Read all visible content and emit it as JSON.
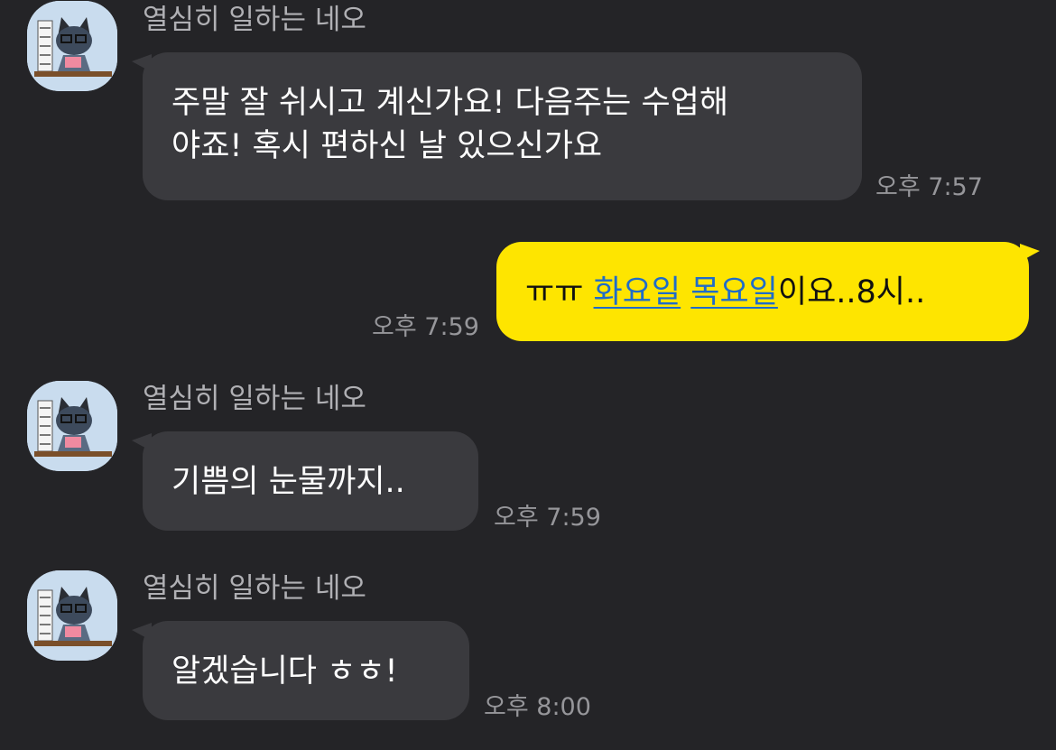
{
  "sender_name": "열심히 일하는 네오",
  "messages": [
    {
      "direction": "incoming",
      "lines": [
        "주말 잘 쉬시고 계신가요! 다음주는 수업해",
        "야죠! 혹시 편하신 날 있으신가요"
      ],
      "time": "오후 7:57"
    },
    {
      "direction": "outgoing",
      "prefix": "ㅠㅠ ",
      "link1": "화요일",
      "space": " ",
      "link2": "목요일",
      "suffix": "이요..8시..",
      "time": "오후 7:59"
    },
    {
      "direction": "incoming",
      "lines": [
        "기쁨의 눈물까지.."
      ],
      "time": "오후 7:59"
    },
    {
      "direction": "incoming",
      "lines": [
        "알겠습니다 ㅎㅎ!"
      ],
      "time": "오후 8:00"
    }
  ],
  "colors": {
    "background": "#242427",
    "incoming_bubble": "#3a3a3e",
    "outgoing_bubble": "#fee500",
    "link": "#1f6cc9",
    "avatar_bg": "#c9dcee"
  },
  "avatar_icon": "neo-cat-working-avatar"
}
